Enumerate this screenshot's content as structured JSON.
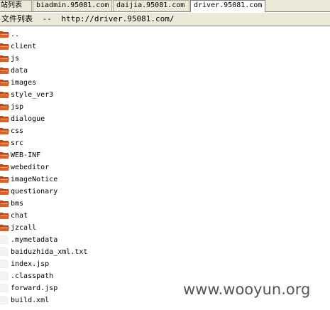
{
  "tabs": [
    {
      "label": "站列表",
      "active": false
    },
    {
      "label": "biadmin.95081.com",
      "active": false
    },
    {
      "label": "daijia.95081.com",
      "active": false
    },
    {
      "label": "driver.95081.com",
      "active": true
    }
  ],
  "path": {
    "label": "文件列表",
    "separator": "--",
    "url": "http://driver.95081.com/"
  },
  "entries": [
    {
      "name": "..",
      "type": "folder"
    },
    {
      "name": "client",
      "type": "folder"
    },
    {
      "name": "js",
      "type": "folder"
    },
    {
      "name": "data",
      "type": "folder"
    },
    {
      "name": "images",
      "type": "folder"
    },
    {
      "name": "style_ver3",
      "type": "folder"
    },
    {
      "name": "jsp",
      "type": "folder"
    },
    {
      "name": "dialogue",
      "type": "folder"
    },
    {
      "name": "css",
      "type": "folder"
    },
    {
      "name": "src",
      "type": "folder"
    },
    {
      "name": "WEB-INF",
      "type": "folder"
    },
    {
      "name": "webeditor",
      "type": "folder"
    },
    {
      "name": "imageNotice",
      "type": "folder"
    },
    {
      "name": "questionary",
      "type": "folder"
    },
    {
      "name": "bms",
      "type": "folder"
    },
    {
      "name": "chat",
      "type": "folder"
    },
    {
      "name": "jzcall",
      "type": "folder"
    },
    {
      "name": ".mymetadata",
      "type": "file"
    },
    {
      "name": "baiduzhida_xml.txt",
      "type": "file"
    },
    {
      "name": "index.jsp",
      "type": "file"
    },
    {
      "name": ".classpath",
      "type": "file"
    },
    {
      "name": "forward.jsp",
      "type": "file"
    },
    {
      "name": "build.xml",
      "type": "file"
    }
  ],
  "watermark": "www.wooyun.org",
  "colors": {
    "folder": "#d9622b",
    "folder_dark": "#b84a1c",
    "file": "#f4f4f4"
  }
}
